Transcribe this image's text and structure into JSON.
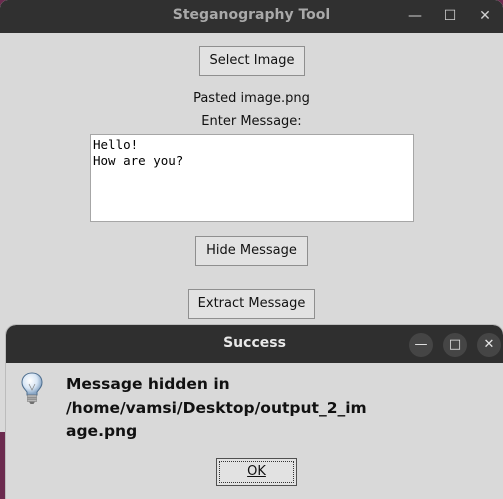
{
  "main_window": {
    "title": "Steganography Tool",
    "controls": {
      "minimize": "—",
      "maximize": "☐",
      "close": "✕"
    },
    "select_image_label": "Select Image",
    "file_name": "Pasted image.png",
    "enter_message_label": "Enter Message:",
    "message_lines": [
      "Hello!",
      "How are you?"
    ],
    "hide_message_label": "Hide Message",
    "extract_message_label": "Extract Message"
  },
  "dialog": {
    "title": "Success",
    "controls": {
      "minimize": "—",
      "maximize": "□",
      "close": "✕"
    },
    "icon": "lightbulb-icon",
    "message_lines": [
      "Message hidden in",
      "/home/vamsi/Desktop/output_2_im",
      "age.png"
    ],
    "ok_label": "OK"
  }
}
